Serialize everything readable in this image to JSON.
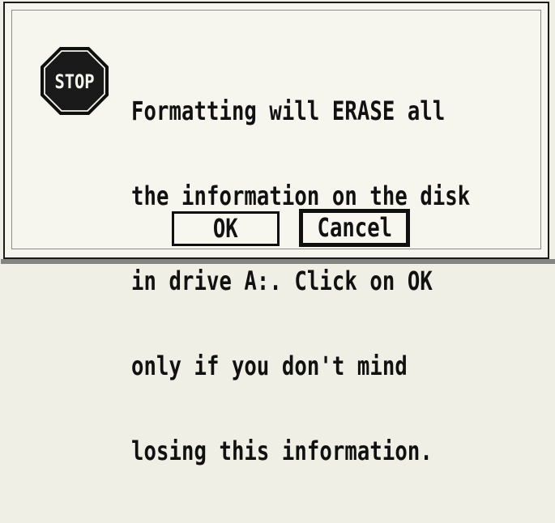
{
  "dialog": {
    "icon": {
      "name": "stop-sign-icon",
      "text": "STOP",
      "color": "#111111"
    },
    "message_lines": [
      "Formatting will ERASE all",
      "the information on the disk",
      "in drive A:. Click on OK",
      "only if you don't mind",
      "losing this information."
    ],
    "buttons": {
      "ok_label": "OK",
      "cancel_label": "Cancel"
    }
  }
}
